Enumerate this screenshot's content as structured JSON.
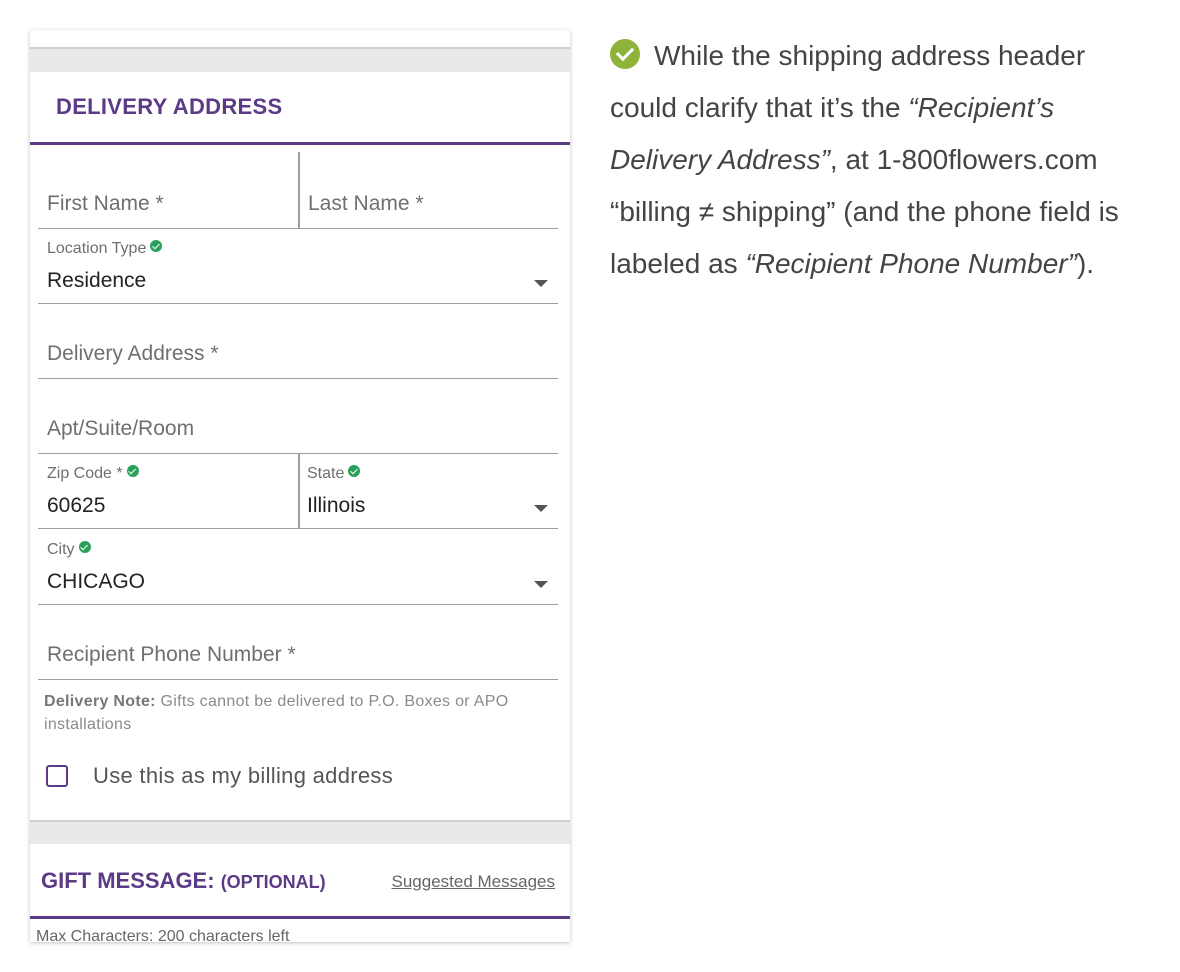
{
  "form": {
    "section_title": "DELIVERY ADDRESS",
    "first_name_placeholder": "First Name *",
    "last_name_placeholder": "Last Name *",
    "location_type_label": "Location Type",
    "location_type_value": "Residence",
    "delivery_address_placeholder": "Delivery Address *",
    "apt_placeholder": "Apt/Suite/Room",
    "zip_label": "Zip Code *",
    "zip_value": "60625",
    "state_label": "State",
    "state_value": "Illinois",
    "city_label": "City",
    "city_value": "CHICAGO",
    "phone_placeholder": "Recipient Phone Number *",
    "delivery_note_bold": "Delivery Note:",
    "delivery_note_text": " Gifts cannot be delivered to P.O. Boxes or APO installations",
    "billing_checkbox_label": "Use this as my billing address",
    "billing_checked": false,
    "gift_title": "GIFT MESSAGE: ",
    "gift_optional": "(OPTIONAL)",
    "suggested_messages": "Suggested Messages",
    "max_characters": "Max Characters: 200 characters left"
  },
  "commentary": {
    "t1": "While the shipping address header could clarify that it’s the ",
    "i1": "“Recipient’s Delivery Address”",
    "t2": ", at 1-800flowers.com “billing ≠ shipping” (and the phone field is labeled as ",
    "i2": "“Recipient Phone Number”",
    "t3": ")."
  },
  "colors": {
    "brand_purple": "#5b3a86",
    "valid_green": "#2aa05a",
    "badge_green": "#8db33a"
  }
}
